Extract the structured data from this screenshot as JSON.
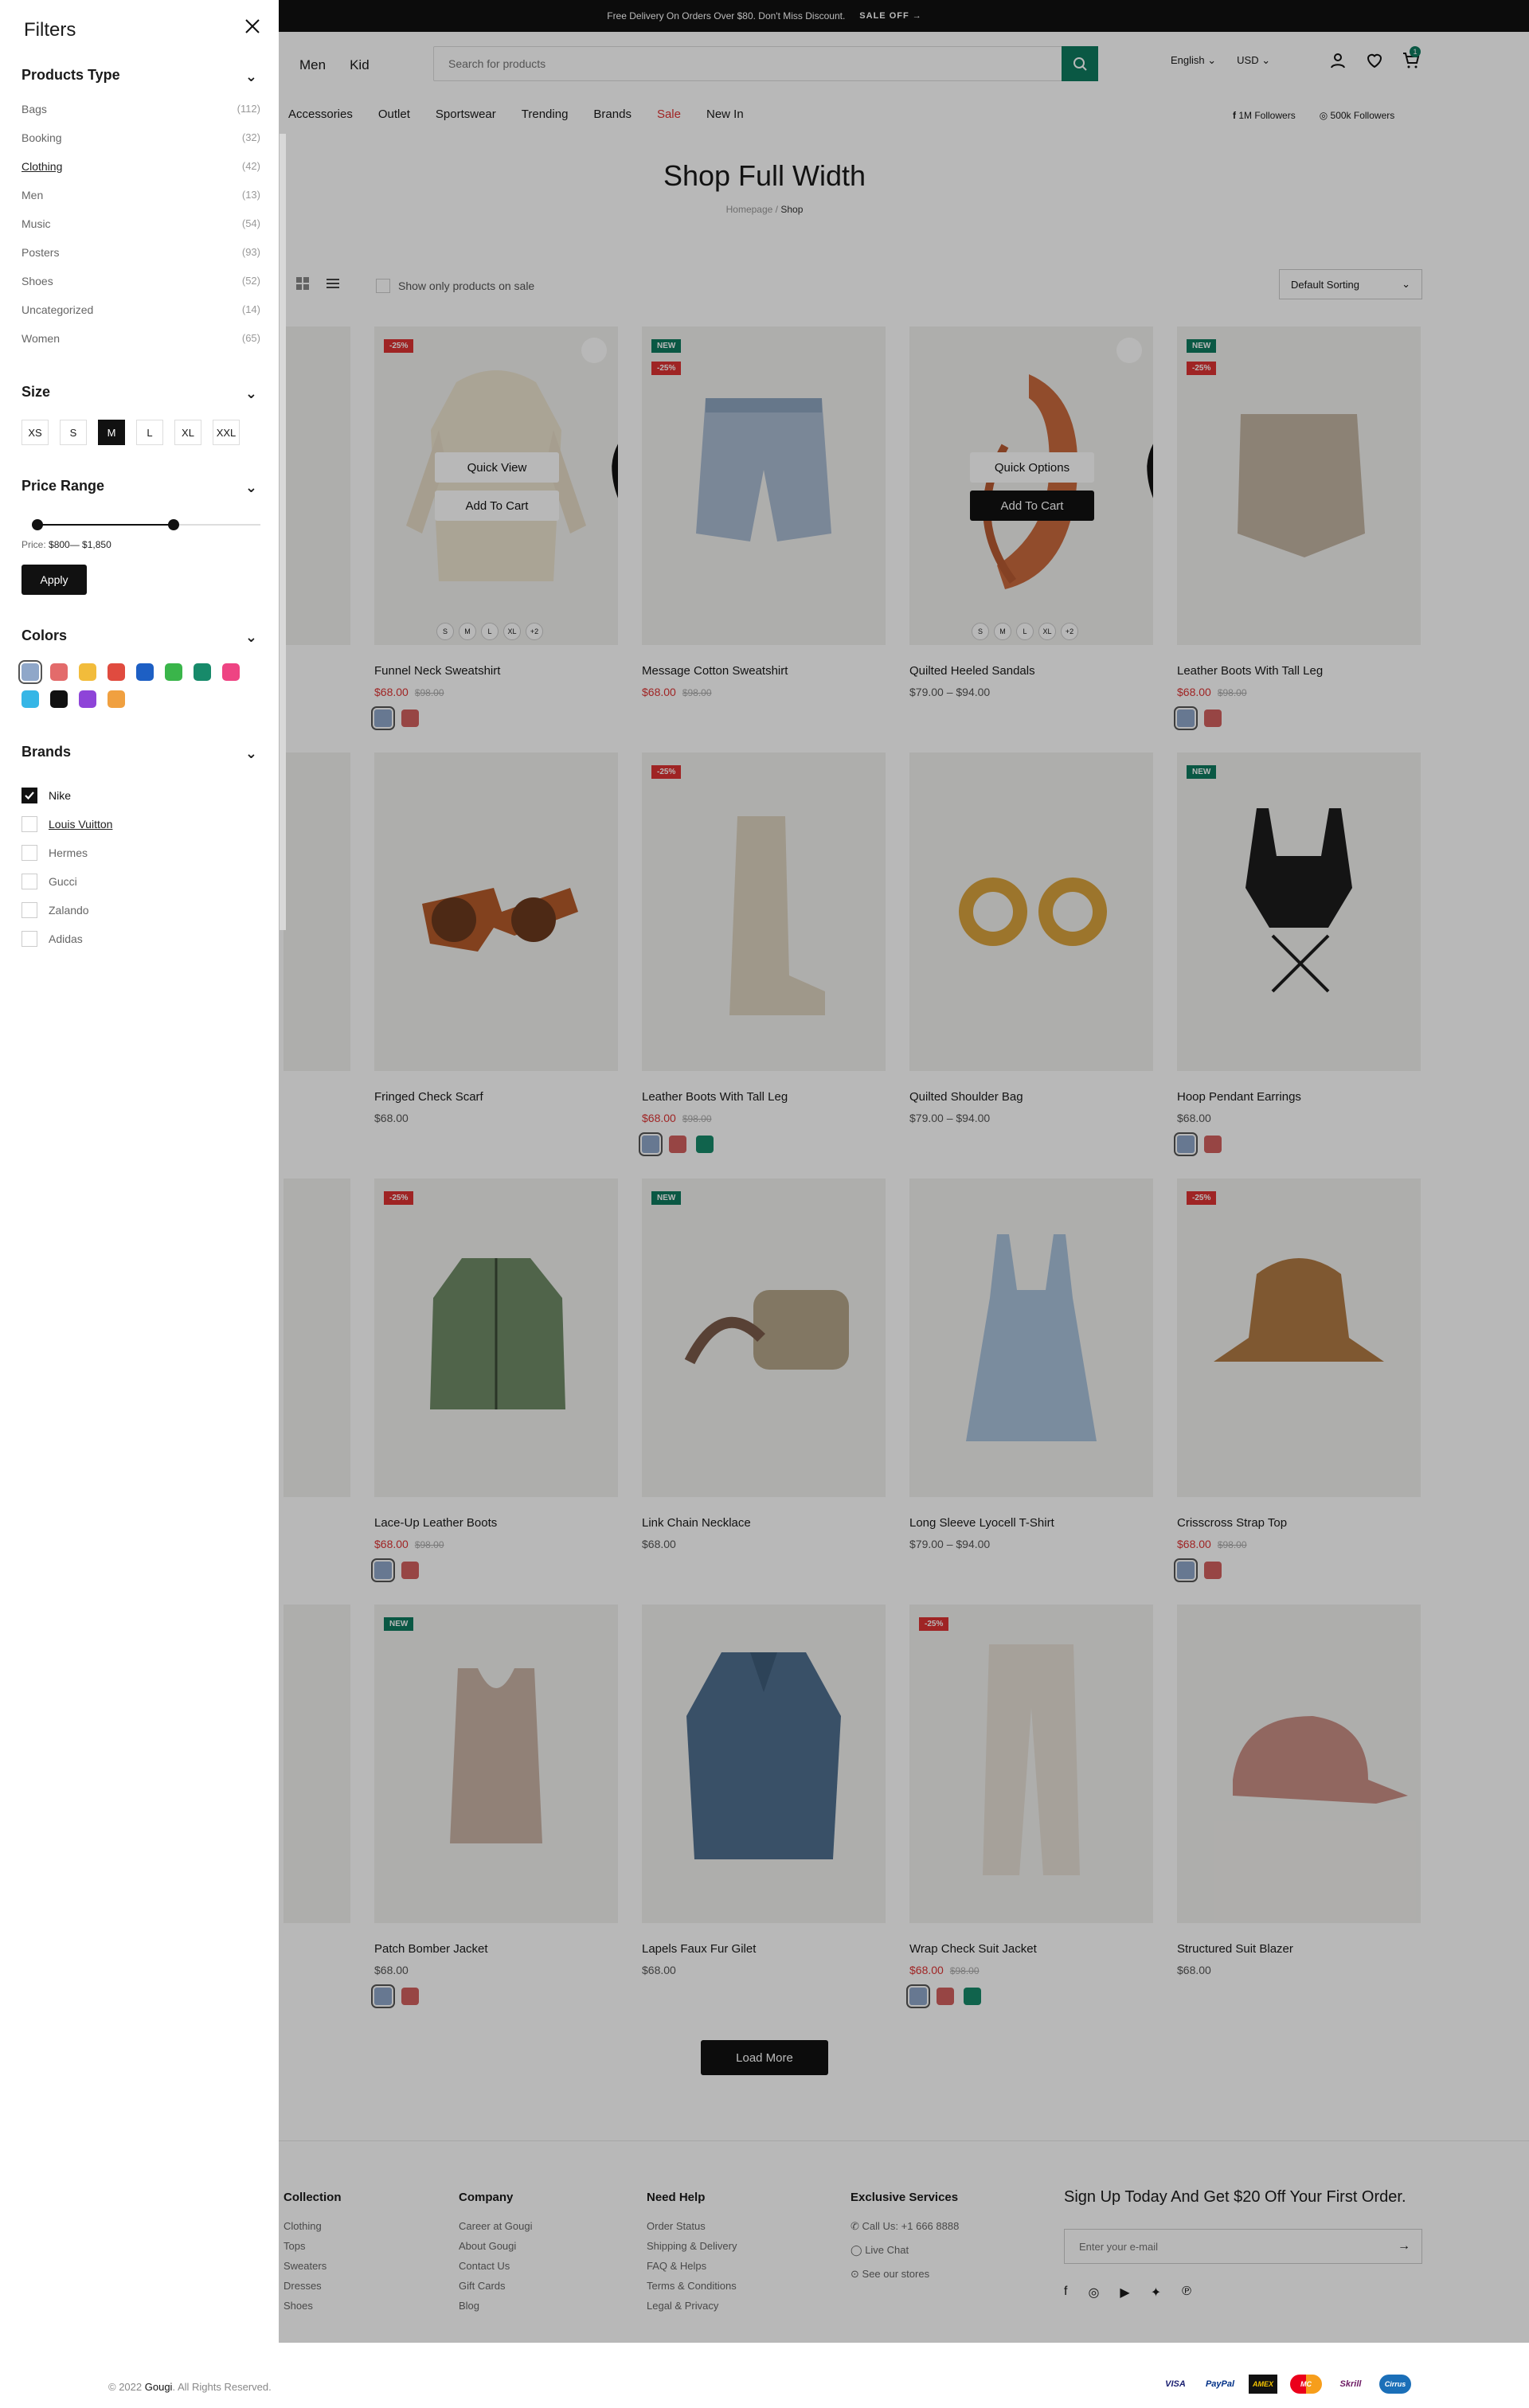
{
  "topbar": {
    "text": "Free Delivery On Orders Over $80. Don't Miss Discount.",
    "sale": "SALE OFF",
    "arrow": "→"
  },
  "header": {
    "nav": [
      "Men",
      "Kid"
    ],
    "search_placeholder": "Search for products",
    "language": "English",
    "currency": "USD",
    "cart_count": "1"
  },
  "catnav": [
    "Accessories",
    "Outlet",
    "Sportswear",
    "Trending",
    "Brands",
    "Sale",
    "New In"
  ],
  "social": {
    "facebook": "1M Followers",
    "instagram": "500k Followers"
  },
  "page": {
    "title": "Shop Full Width",
    "crumb_home": "Homepage",
    "crumb_sep": "/",
    "crumb_current": "Shop"
  },
  "toolbar": {
    "onsale": "Show only products on sale",
    "sorting": "Default Sorting"
  },
  "card_actions": {
    "quick_view": "Quick View",
    "add_to_cart": "Add To Cart",
    "quick_options": "Quick Options"
  },
  "product_sizes": [
    "S",
    "M",
    "L",
    "XL",
    "+2"
  ],
  "colors": {
    "blue": "#8fa7c9",
    "red": "#d2605f",
    "green": "#178a6a",
    "accent": "#0f7b5f",
    "sale": "#dd3333"
  },
  "products": [
    {
      "name": "Funnel Neck Sweatshirt",
      "price": "$68.00",
      "old": "$98.00",
      "badges": [
        "-25%"
      ],
      "swatches": [
        "blue",
        "red"
      ]
    },
    {
      "name": "Message Cotton Sweatshirt",
      "price": "$68.00",
      "old": "$98.00",
      "badges": [
        "NEW",
        "-25%"
      ],
      "swatches": []
    },
    {
      "name": "Quilted Heeled Sandals",
      "price": "$79.00 – $94.00",
      "old": "",
      "badges": [],
      "swatches": []
    },
    {
      "name": "Leather Boots With Tall Leg",
      "price": "$68.00",
      "old": "$98.00",
      "badges": [
        "NEW",
        "-25%"
      ],
      "swatches": [
        "blue",
        "red"
      ]
    },
    {
      "name": "Fringed Check Scarf",
      "price": "$68.00",
      "old": "",
      "badges": [],
      "swatches": []
    },
    {
      "name": "Leather Boots With Tall Leg",
      "price": "$68.00",
      "old": "$98.00",
      "badges": [
        "-25%"
      ],
      "swatches": [
        "blue",
        "red",
        "green"
      ]
    },
    {
      "name": "Quilted Shoulder Bag",
      "price": "$79.00 – $94.00",
      "old": "",
      "badges": [],
      "swatches": []
    },
    {
      "name": "Hoop Pendant Earrings",
      "price": "$68.00",
      "old": "",
      "badges": [
        "NEW"
      ],
      "swatches": [
        "blue",
        "red"
      ]
    },
    {
      "name": "Lace-Up Leather Boots",
      "price": "$68.00",
      "old": "$98.00",
      "badges": [
        "-25%"
      ],
      "swatches": [
        "blue",
        "red"
      ]
    },
    {
      "name": "Link Chain Necklace",
      "price": "$68.00",
      "old": "",
      "badges": [
        "NEW"
      ],
      "swatches": []
    },
    {
      "name": "Long Sleeve Lyocell T-Shirt",
      "price": "$79.00 – $94.00",
      "old": "",
      "badges": [],
      "swatches": []
    },
    {
      "name": "Crisscross Strap Top",
      "price": "$68.00",
      "old": "$98.00",
      "badges": [
        "-25%"
      ],
      "swatches": [
        "blue",
        "red"
      ]
    },
    {
      "name": "Patch Bomber Jacket",
      "price": "$68.00",
      "old": "",
      "badges": [
        "NEW"
      ],
      "swatches": [
        "blue",
        "red"
      ]
    },
    {
      "name": "Lapels Faux Fur Gilet",
      "price": "$68.00",
      "old": "",
      "badges": [],
      "swatches": []
    },
    {
      "name": "Wrap Check Suit Jacket",
      "price": "$68.00",
      "old": "$98.00",
      "badges": [
        "-25%"
      ],
      "swatches": [
        "blue",
        "red",
        "green"
      ]
    },
    {
      "name": "Structured Suit Blazer",
      "price": "$68.00",
      "old": "",
      "badges": [],
      "swatches": []
    }
  ],
  "load_more": "Load More",
  "footer": {
    "collection": {
      "title": "Collection",
      "items": [
        "Clothing",
        "Tops",
        "Sweaters",
        "Dresses",
        "Shoes"
      ]
    },
    "company": {
      "title": "Company",
      "items": [
        "Career at Gougi",
        "About Gougi",
        "Contact Us",
        "Gift Cards",
        "Blog"
      ]
    },
    "help": {
      "title": "Need Help",
      "items": [
        "Order Status",
        "Shipping & Delivery",
        "FAQ & Helps",
        "Terms & Conditions",
        "Legal & Privacy"
      ]
    },
    "services": {
      "title": "Exclusive Services",
      "items": [
        "Call Us: +1 666 8888",
        "Live Chat",
        "See our stores"
      ]
    },
    "newsletter": {
      "title": "Sign Up Today And Get $20 Off Your First Order.",
      "placeholder": "Enter your e-mail"
    }
  },
  "bottom": {
    "copy_prefix": "© 2022",
    "brand": "Gougi",
    "copy_suffix": ". All Rights Reserved.",
    "payments": [
      "VISA",
      "PayPal",
      "AMEX",
      "MC",
      "Skrill",
      "Cirrus"
    ]
  },
  "filters": {
    "title": "Filters",
    "products_type": {
      "title": "Products Type",
      "items": [
        {
          "label": "Bags",
          "count": "(112)"
        },
        {
          "label": "Booking",
          "count": "(32)"
        },
        {
          "label": "Clothing",
          "count": "(42)"
        },
        {
          "label": "Men",
          "count": "(13)"
        },
        {
          "label": "Music",
          "count": "(54)"
        },
        {
          "label": "Posters",
          "count": "(93)"
        },
        {
          "label": "Shoes",
          "count": "(52)"
        },
        {
          "label": "Uncategorized",
          "count": "(14)"
        },
        {
          "label": "Women",
          "count": "(65)"
        }
      ]
    },
    "size": {
      "title": "Size",
      "options": [
        "XS",
        "S",
        "M",
        "L",
        "XL",
        "XXL"
      ],
      "selected": "M"
    },
    "price": {
      "title": "Price Range",
      "label": "Price:",
      "value": "$800— $1,850",
      "apply": "Apply",
      "min_fraction": 0.0,
      "max_fraction": 0.61
    },
    "colors": {
      "title": "Colors",
      "swatches": [
        "#8fa7c9",
        "#e36b6b",
        "#f2bc3b",
        "#e04b3f",
        "#1d5fc4",
        "#3ab54a",
        "#178a6a",
        "#ee4483",
        "#36b6e6",
        "#111111",
        "#8e44d8",
        "#f0a040"
      ]
    },
    "brands": {
      "title": "Brands",
      "items": [
        "Nike",
        "Louis Vuitton",
        "Hermes",
        "Gucci",
        "Zalando",
        "Adidas"
      ],
      "checked": "Nike"
    }
  }
}
